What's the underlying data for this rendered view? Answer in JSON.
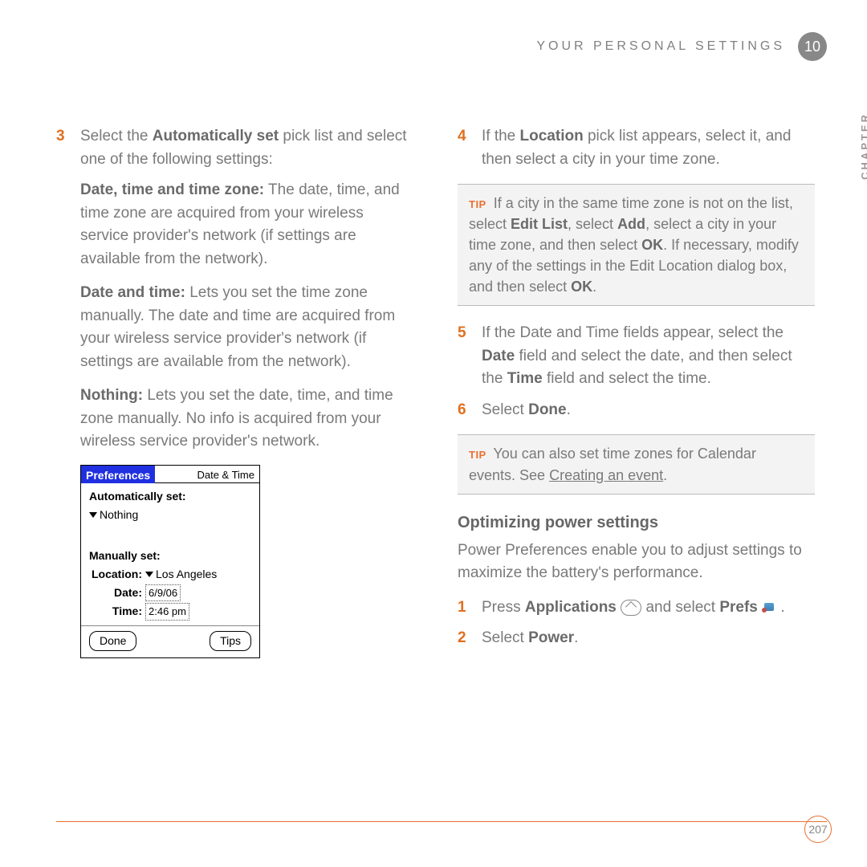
{
  "header": {
    "section_title": "YOUR PERSONAL SETTINGS",
    "chapter_number": "10",
    "chapter_side": "CHAPTER"
  },
  "left": {
    "step3_num": "3",
    "step3_a": "Select the ",
    "step3_b": "Automatically set",
    "step3_c": " pick list and select one of the following settings:",
    "dtz_label": "Date, time and time zone:",
    "dtz_text": " The date, time, and time zone are acquired from your wireless service provider's network (if settings are available from the network).",
    "dt_label": "Date and time:",
    "dt_text": " Lets you set the time zone manually. The date and time are acquired from your wireless service provider's network (if settings are available from the network).",
    "n_label": "Nothing:",
    "n_text": " Lets you set the date, time, and time zone manually. No info is acquired from your wireless service provider's network."
  },
  "prefs": {
    "tab": "Preferences",
    "title": "Date & Time",
    "auto_label": "Automatically set:",
    "auto_value": "Nothing",
    "manual_label": "Manually set:",
    "loc_label": "Location:",
    "loc_value": "Los Angeles",
    "date_label": "Date:",
    "date_value": "6/9/06",
    "time_label": "Time:",
    "time_value": "2:46 pm",
    "done": "Done",
    "tips": "Tips"
  },
  "right": {
    "step4_num": "4",
    "step4_a": "If the ",
    "step4_b": "Location",
    "step4_c": " pick list appears, select it, and then select a city in your time zone.",
    "tip1_label": "TIP",
    "tip1_a": " If a city in the same time zone is not on the list, select ",
    "tip1_b": "Edit List",
    "tip1_c": ", select ",
    "tip1_d": "Add",
    "tip1_e": ", select a city in your time zone, and then select ",
    "tip1_f": "OK",
    "tip1_g": ". If necessary, modify any of the settings in the Edit Location dialog box, and then select ",
    "tip1_h": "OK",
    "tip1_i": ".",
    "step5_num": "5",
    "step5_a": "If the Date and Time fields appear, select the ",
    "step5_b": "Date",
    "step5_c": " field and select the date, and then select the ",
    "step5_d": "Time",
    "step5_e": " field and select the time.",
    "step6_num": "6",
    "step6_a": "Select ",
    "step6_b": "Done",
    "step6_c": ".",
    "tip2_label": "TIP",
    "tip2_a": " You can also set time zones for Calendar events. See ",
    "tip2_link": "Creating an event",
    "tip2_b": ".",
    "subhead": "Optimizing power settings",
    "power_para": "Power Preferences enable you to adjust settings to maximize the battery's performance.",
    "p1_num": "1",
    "p1_a": "Press ",
    "p1_b": "Applications",
    "p1_c": " and select ",
    "p1_d": "Prefs",
    "p1_e": " .",
    "p2_num": "2",
    "p2_a": "Select ",
    "p2_b": "Power",
    "p2_c": "."
  },
  "footer": {
    "page_number": "207"
  }
}
